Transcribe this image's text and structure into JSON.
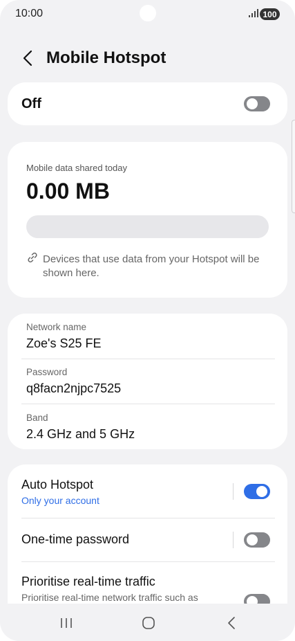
{
  "status_bar": {
    "time": "10:00",
    "battery": "100"
  },
  "header": {
    "title": "Mobile Hotspot"
  },
  "master_toggle": {
    "label": "Off",
    "on": false
  },
  "data_usage": {
    "label": "Mobile data shared today",
    "value": "0.00 MB",
    "progress": 0,
    "note": "Devices that use data from your Hotspot will be shown here."
  },
  "network": {
    "name_label": "Network name",
    "name_value": "Zoe's S25 FE",
    "password_label": "Password",
    "password_value": "q8facn2njpc7525",
    "band_label": "Band",
    "band_value": "2.4 GHz and 5 GHz"
  },
  "options": {
    "auto_hotspot": {
      "title": "Auto Hotspot",
      "subtitle": "Only your account",
      "on": true
    },
    "one_time_password": {
      "title": "One-time password",
      "on": false
    },
    "prioritise": {
      "title": "Prioritise real-time traffic",
      "subtitle": "Prioritise real-time network traffic such as",
      "on": false
    }
  },
  "icons": {
    "back": "back-arrow-icon",
    "link": "link-icon",
    "recents": "recents-icon",
    "home": "home-icon",
    "nav_back": "nav-back-icon"
  },
  "colors": {
    "accent": "#2f6ee6",
    "toggle_off": "#85868a",
    "background": "#f2f2f4",
    "card": "#ffffff"
  }
}
